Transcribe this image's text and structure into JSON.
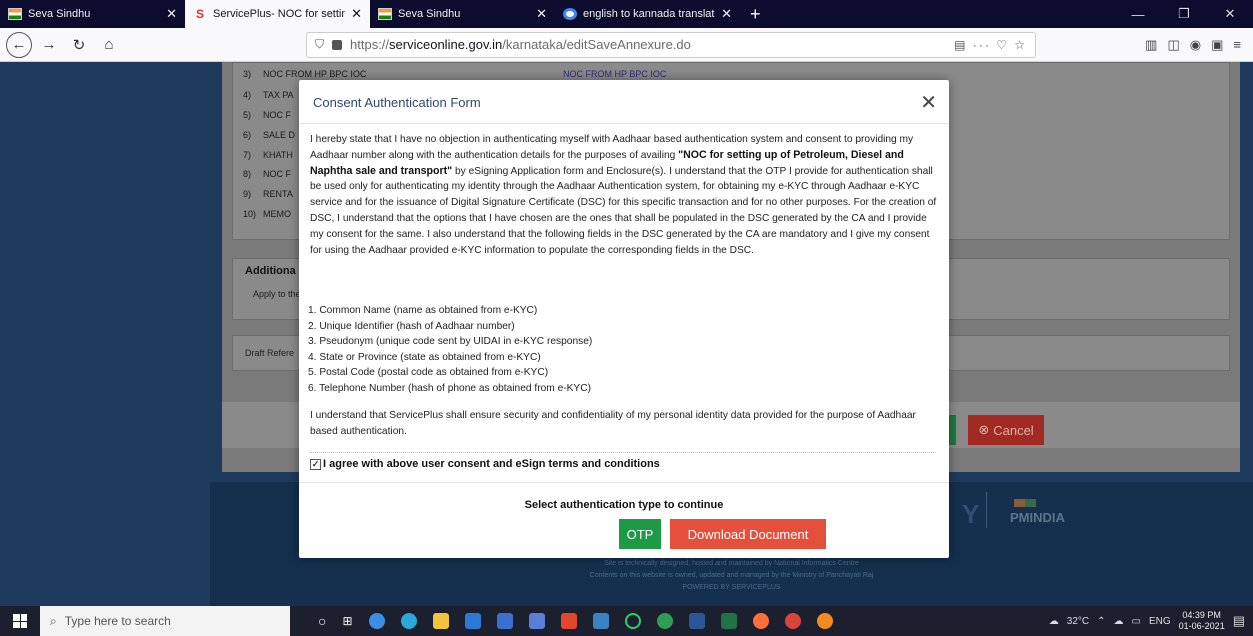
{
  "browser": {
    "tabs": [
      {
        "label": "Seva Sindhu",
        "icon": "seva-sindhu-favicon",
        "active": false
      },
      {
        "label": "ServicePlus- NOC for setting up",
        "icon": "serviceplus-favicon",
        "active": true
      },
      {
        "label": "Seva Sindhu",
        "icon": "seva-sindhu-favicon",
        "active": false
      },
      {
        "label": "english to kannada translator -",
        "icon": "google-favicon",
        "active": false
      }
    ],
    "url_prefix": "https://",
    "url_host": "serviceonline.gov.in",
    "url_path": "/karnataka/editSaveAnnexure.do"
  },
  "background": {
    "annexure_items": [
      {
        "num": "3)",
        "text": "NOC FROM HP BPC IOC"
      },
      {
        "num": "4)",
        "text": "TAX PA"
      },
      {
        "num": "5)",
        "text": "NOC F"
      },
      {
        "num": "6)",
        "text": "SALE D"
      },
      {
        "num": "7)",
        "text": "KHATH"
      },
      {
        "num": "8)",
        "text": "NOC F"
      },
      {
        "num": "9)",
        "text": "RENTA"
      },
      {
        "num": "10)",
        "text": "MEMO"
      }
    ],
    "noc_link": "NOC FROM HP BPC IOC",
    "additional_title": "Additiona",
    "additional_sub": "Apply to the",
    "draft_label": "Draft Refere",
    "cancel_label": "Cancel",
    "pmindia": "PMINDIA",
    "footer_lines": [
      "Site is technically designed, hosted and maintained by National Informatics Centre",
      "Contents on this website is owned, updated and managed by the Ministry of Panchayati Raj",
      "POWERED BY SERVICEPLUS"
    ]
  },
  "modal": {
    "title": "Consent Authentication Form",
    "close_symbol": "✕",
    "para1_a": "I hereby state that I have no objection in authenticating myself with Aadhaar based authentication system and consent to providing my Aadhaar number along with the authentication details for the purposes of availing ",
    "para1_bold": "\"NOC for setting up of Petroleum, Diesel and Naphtha sale and transport\"",
    "para1_b": " by eSigning Application form and Enclosure(s). I understand that the OTP I provide for authentication shall be used only for authenticating my identity through the Aadhaar Authentication system, for obtaining my e-KYC through Aadhaar e-KYC service and for the issuance of Digital Signature Certificate (DSC) for this specific transaction and for no other purposes. For the creation of DSC, I understand that the options that I have chosen are the ones that shall be populated in the DSC generated by the CA and I provide my consent for the same. I also understand that the following fields in the DSC generated by the CA are mandatory and I give my consent for using the Aadhaar provided e-KYC information to populate the corresponding fields in the DSC.",
    "fields": [
      "1. Common Name (name as obtained from e-KYC)",
      "2. Unique Identifier (hash of Aadhaar number)",
      "3. Pseudonym (unique code sent by UIDAI in e-KYC response)",
      "4. State or Province (state as obtained from e-KYC)",
      "5. Postal Code (postal code as obtained from e-KYC)",
      "6. Telephone Number (hash of phone as obtained from e-KYC)"
    ],
    "security_text": "I understand that ServicePlus shall ensure security and confidentiality of my personal identity data provided for the purpose of Aadhaar based authentication.",
    "agree_label": "I agree with above user consent and eSign terms and conditions",
    "agree_checked": true,
    "select_auth": "Select authentication type to continue",
    "otp_label": "OTP",
    "download_label": "Download Document"
  },
  "taskbar": {
    "search_placeholder": "Type here to search",
    "temperature": "32°C",
    "language": "ENG",
    "time": "04:39 PM",
    "date": "01-06-2021"
  }
}
